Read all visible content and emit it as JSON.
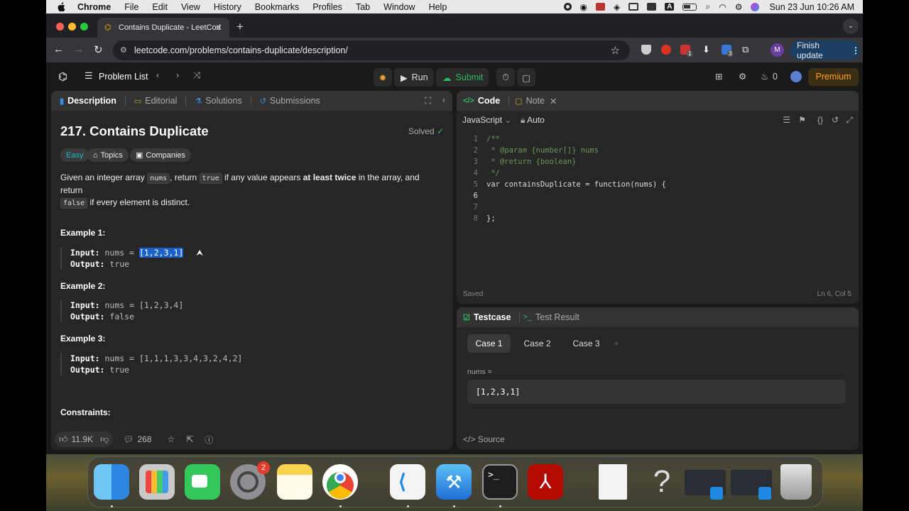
{
  "menubar": {
    "app": "Chrome",
    "items": [
      "File",
      "Edit",
      "View",
      "History",
      "Bookmarks",
      "Profiles",
      "Tab",
      "Window",
      "Help"
    ],
    "datetime": "Sun 23 Jun  10:26 AM"
  },
  "browser": {
    "tab_title": "Contains Duplicate - LeetCod",
    "url": "leetcode.com/problems/contains-duplicate/description/",
    "profile_initial": "M",
    "finish_update": "Finish update",
    "ext_badge_1": "1",
    "ext_badge_2": "3"
  },
  "lc_nav": {
    "problem_list": "Problem List",
    "run": "Run",
    "submit": "Submit",
    "streak": "0",
    "premium": "Premium"
  },
  "desc_tabs": [
    "Description",
    "Editorial",
    "Solutions",
    "Submissions"
  ],
  "problem": {
    "title": "217. Contains Duplicate",
    "status": "Solved",
    "difficulty": "Easy",
    "topics": "Topics",
    "companies": "Companies",
    "p1": "Given an integer array ",
    "c1": "nums",
    "p2": ", return ",
    "c2": "true",
    "p3": " if any value appears ",
    "b1": "at least twice",
    "p4": " in the array, and return",
    "c3": "false",
    "p5": " if every element is distinct.",
    "examples": [
      {
        "title": "Example 1:",
        "input_label": "Input:",
        "input_pre": "nums = ",
        "input_val": "[1,2,3,1]",
        "output_label": "Output:",
        "output": "true"
      },
      {
        "title": "Example 2:",
        "input_label": "Input:",
        "input_pre": "nums = ",
        "input_val": "[1,2,3,4]",
        "output_label": "Output:",
        "output": "false"
      },
      {
        "title": "Example 3:",
        "input_label": "Input:",
        "input_pre": "nums = ",
        "input_val": "[1,1,1,3,3,4,3,2,4,2]",
        "output_label": "Output:",
        "output": "true"
      }
    ],
    "constraints": "Constraints:"
  },
  "desc_footer": {
    "likes": "11.9K",
    "comments": "268"
  },
  "code_panel": {
    "tab_code": "Code",
    "tab_note": "Note",
    "language": "JavaScript",
    "auto": "Auto",
    "lines": [
      {
        "n": "1",
        "t": "/**"
      },
      {
        "n": "2",
        "t": " * @param {number[]} nums"
      },
      {
        "n": "3",
        "t": " * @return {boolean}"
      },
      {
        "n": "4",
        "t": " */"
      },
      {
        "n": "5",
        "t": "var containsDuplicate = function(nums) {"
      },
      {
        "n": "6",
        "t": ""
      },
      {
        "n": "7",
        "t": ""
      },
      {
        "n": "8",
        "t": "};"
      }
    ],
    "saved": "Saved",
    "cursor": "Ln 6, Col 5"
  },
  "test_panel": {
    "tab_testcase": "Testcase",
    "tab_result": "Test Result",
    "cases": [
      "Case 1",
      "Case 2",
      "Case 3"
    ],
    "nums_label": "nums =",
    "nums_value": "[1,2,3,1]",
    "source": "Source"
  },
  "dock": {
    "settings_badge": "2"
  },
  "colors": {
    "accent": "#ffa116",
    "run_green": "#2cbb5d",
    "selection": "#1a62c7"
  }
}
